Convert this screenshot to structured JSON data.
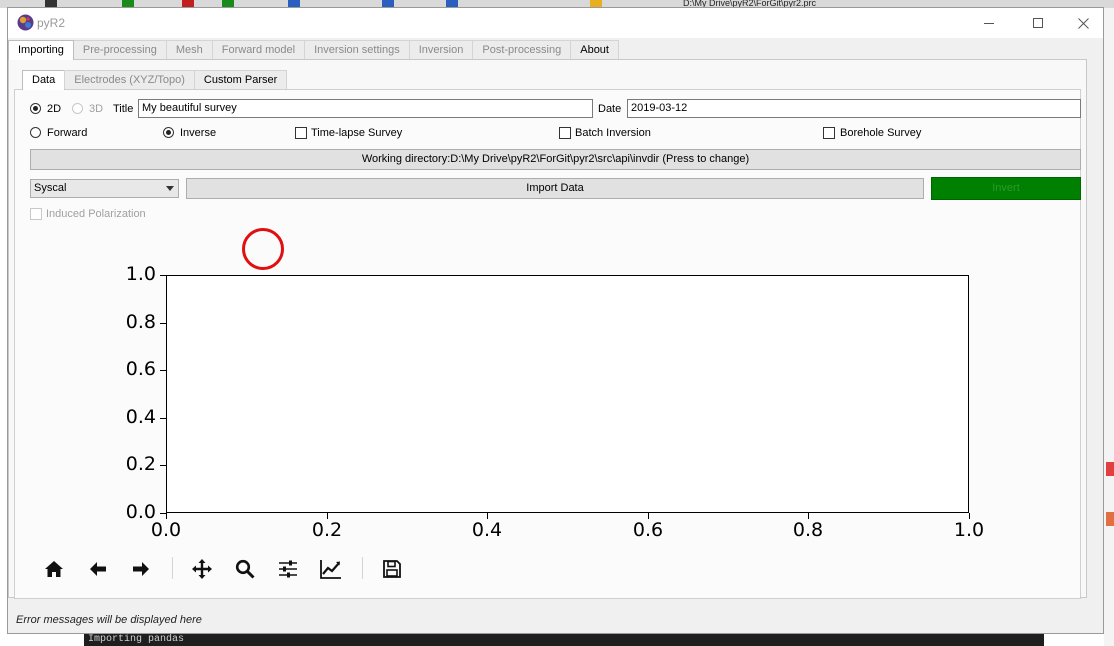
{
  "background": {
    "path_fragment": "D:\\My Drive\\pyR2\\ForGit\\pyr2.prc",
    "terminal_text": "Importing  pandas"
  },
  "window": {
    "title": "pyR2",
    "icon": "pyr2-logo-icon",
    "controls": [
      "minimize-icon",
      "maximize-icon",
      "close-icon"
    ]
  },
  "main_tabs": [
    {
      "label": "Importing",
      "active": true
    },
    {
      "label": "Pre-processing"
    },
    {
      "label": "Mesh"
    },
    {
      "label": "Forward model"
    },
    {
      "label": "Inversion settings"
    },
    {
      "label": "Inversion"
    },
    {
      "label": "Post-processing"
    },
    {
      "label": "About"
    }
  ],
  "sub_tabs": [
    {
      "label": "Data",
      "active": true
    },
    {
      "label": "Electrodes (XYZ/Topo)"
    },
    {
      "label": "Custom Parser"
    }
  ],
  "dimension": {
    "option_2d": "2D",
    "option_3d": "3D",
    "selected": "2D"
  },
  "title_field": {
    "label": "Title",
    "value": "My beautiful survey"
  },
  "date_field": {
    "label": "Date",
    "value": "2019-03-12"
  },
  "mode": {
    "forward": "Forward",
    "inverse": "Inverse",
    "selected": "Inverse"
  },
  "options": {
    "timelapse": "Time-lapse Survey",
    "batch": "Batch Inversion",
    "borehole": "Borehole Survey"
  },
  "working_dir_button": "Working directory:D:\\My Drive\\pyR2\\ForGit\\pyr2\\src\\api\\invdir (Press to change)",
  "format_select": {
    "value": "Syscal"
  },
  "import_button": "Import Data",
  "invert_button": "Invert",
  "induced_polarization": "Induced Polarization",
  "chart_data": {
    "type": "line",
    "series": [],
    "xlim": [
      0.0,
      1.0
    ],
    "ylim": [
      0.0,
      1.0
    ],
    "xticks": [
      "0.0",
      "0.2",
      "0.4",
      "0.6",
      "0.8",
      "1.0"
    ],
    "yticks": [
      "0.0",
      "0.2",
      "0.4",
      "0.6",
      "0.8",
      "1.0"
    ],
    "grid": false
  },
  "plot_toolbar": [
    "home-icon",
    "back-arrow-icon",
    "forward-arrow-icon",
    "pan-icon",
    "zoom-icon",
    "subplots-config-icon",
    "edit-curves-icon",
    "save-figure-icon"
  ],
  "status_message": "Error messages will be displayed here"
}
